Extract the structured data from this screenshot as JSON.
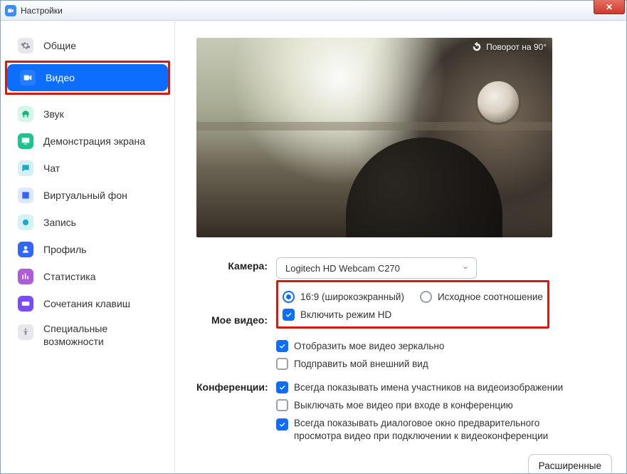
{
  "window": {
    "title": "Настройки"
  },
  "sidebar": {
    "items": [
      {
        "label": "Общие",
        "color": "#bfc4ca"
      },
      {
        "label": "Видео",
        "color": "#ffffff",
        "active": true
      },
      {
        "label": "Звук",
        "color": "#1fc38f"
      },
      {
        "label": "Демонстрация экрана",
        "color": "#1fc38f"
      },
      {
        "label": "Чат",
        "color": "#1fa8c3"
      },
      {
        "label": "Виртуальный фон",
        "color": "#2f66ff"
      },
      {
        "label": "Запись",
        "color": "#1fa8c3"
      },
      {
        "label": "Профиль",
        "color": "#2f66ff"
      },
      {
        "label": "Статистика",
        "color": "#b05bd6"
      },
      {
        "label": "Сочетания клавиш",
        "color": "#7a4bff"
      },
      {
        "label": "Специальные возможности",
        "color": "#8f97a1"
      }
    ]
  },
  "preview": {
    "rotate_label": "Поворот на 90°"
  },
  "form": {
    "camera_label": "Камера:",
    "camera_value": "Logitech HD Webcam C270",
    "aspect_wide": "16:9 (широкоэкранный)",
    "aspect_orig": "Исходное соотношение",
    "my_video_label": "Мое видео:",
    "hd": "Включить режим HD",
    "mirror": "Отобразить мое видео зеркально",
    "touchup": "Подправить мой внешний вид",
    "conf_label": "Конференции:",
    "show_names": "Всегда показывать имена участников на видеоизображении",
    "off_on_join": "Выключать мое видео при входе в конференцию",
    "preview_dialog": "Всегда показывать диалоговое окно предварительного просмотра видео при подключении к видеоконференции",
    "advanced": "Расширенные"
  }
}
